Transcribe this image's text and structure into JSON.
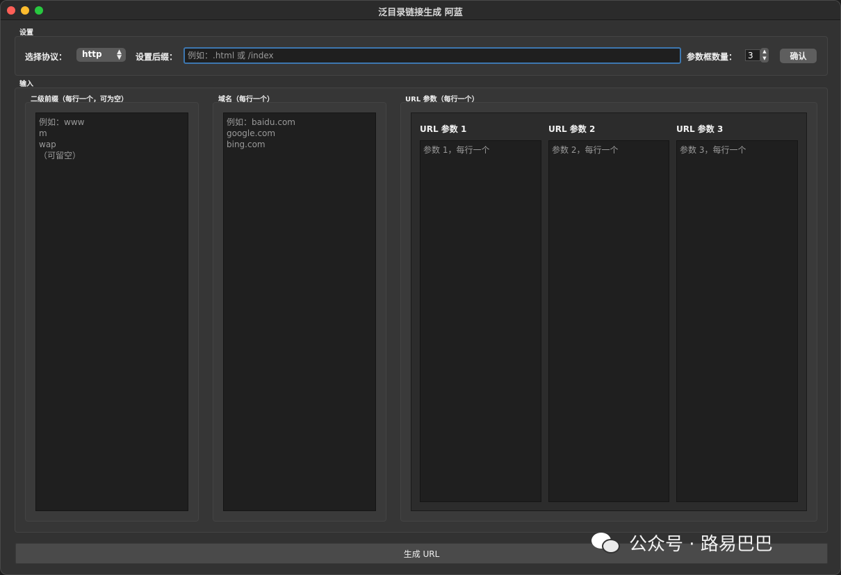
{
  "window": {
    "title": "泛目录链接生成 阿蓝"
  },
  "settings": {
    "group_title": "设置",
    "protocol_label": "选择协议：",
    "protocol_value": "http",
    "suffix_label": "设置后缀：",
    "suffix_placeholder": "例如：.html 或 /index",
    "param_count_label": "参数框数量：",
    "param_count_value": "3",
    "confirm_label": "确认"
  },
  "input": {
    "group_title": "输入",
    "subdomain": {
      "title": "二级前缀（每行一个，可为空）",
      "placeholder": "例如：www\nm\nwap\n（可留空）"
    },
    "domain": {
      "title": "域名（每行一个）",
      "placeholder": "例如：baidu.com\ngoogle.com\nbing.com"
    },
    "url_params": {
      "title": "URL 参数（每行一个）",
      "columns": [
        {
          "header": "URL 参数 1",
          "placeholder": "参数 1，每行一个"
        },
        {
          "header": "URL 参数 2",
          "placeholder": "参数 2，每行一个"
        },
        {
          "header": "URL 参数 3",
          "placeholder": "参数 3，每行一个"
        }
      ]
    }
  },
  "generate_label": "生成 URL",
  "watermark": {
    "text": "公众号 · 路易巴巴",
    "icon": "wechat-icon"
  }
}
